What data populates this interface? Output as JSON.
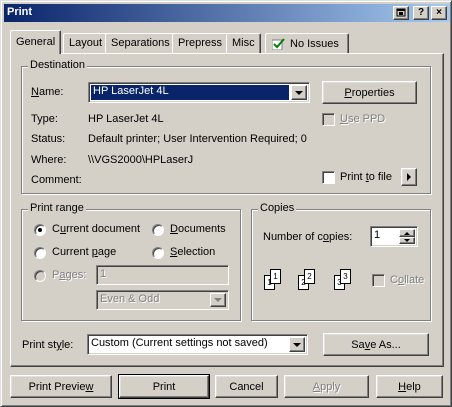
{
  "window": {
    "title": "Print"
  },
  "titlebar_buttons": {
    "context_help": "?",
    "close": "×"
  },
  "tabs": [
    {
      "label": "General",
      "active": true
    },
    {
      "label": "Layout"
    },
    {
      "label": "Separations"
    },
    {
      "label": "Prepress"
    },
    {
      "label": "Misc"
    },
    {
      "label": "No Issues",
      "icon": "checkmark-icon"
    }
  ],
  "destination": {
    "legend": "Destination",
    "name_label": "Name:",
    "name_value": "HP LaserJet 4L",
    "properties_button": "Properties",
    "use_ppd_label": "Use PPD",
    "type_label": "Type:",
    "type_value": "HP LaserJet 4L",
    "status_label": "Status:",
    "status_value": "Default printer; User Intervention Required; 0",
    "where_label": "Where:",
    "where_value": "\\\\VGS2000\\HPLaserJ",
    "comment_label": "Comment:",
    "comment_value": "",
    "print_to_file_label": "Print to file"
  },
  "print_range": {
    "legend": "Print range",
    "current_document": "Current document",
    "documents": "Documents",
    "current_page": "Current page",
    "selection": "Selection",
    "pages_label": "Pages:",
    "pages_value": "1",
    "page_set": "Even & Odd",
    "selected": "current_document"
  },
  "copies": {
    "legend": "Copies",
    "number_label": "Number of copies:",
    "number_value": "1",
    "collate_label": "Collate",
    "page_numbers": [
      "1",
      "1",
      "2",
      "2",
      "3",
      "3"
    ]
  },
  "print_style": {
    "label": "Print style:",
    "value": "Custom (Current settings not saved)",
    "save_as_button": "Save As..."
  },
  "footer": {
    "print_preview": "Print Preview",
    "print": "Print",
    "cancel": "Cancel",
    "apply": "Apply",
    "help": "Help"
  },
  "colors": {
    "title_start": "#0a246a",
    "title_end": "#a6caf0",
    "selection": "#0a246a",
    "face": "#d4d0c8"
  }
}
